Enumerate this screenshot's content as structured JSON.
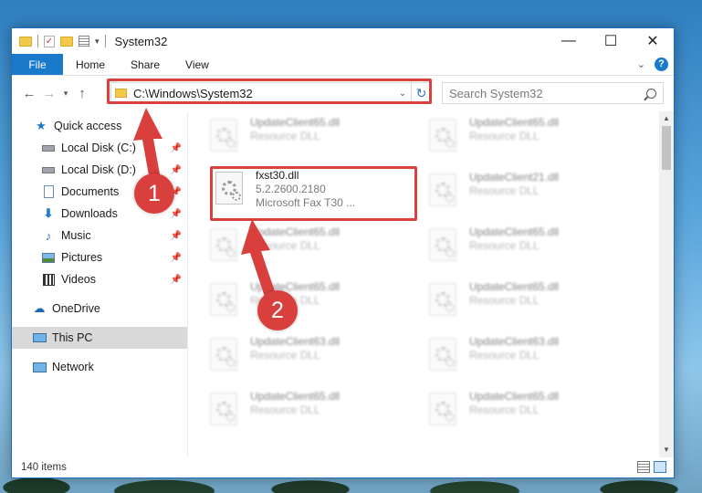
{
  "window": {
    "title": "System32",
    "controls": {
      "minimize": "—",
      "maximize": "☐",
      "close": "✕"
    }
  },
  "ribbon": {
    "tabs": [
      "File",
      "Home",
      "Share",
      "View"
    ],
    "help": "?"
  },
  "address": {
    "path": "C:\\Windows\\System32",
    "search_placeholder": "Search System32"
  },
  "nav": {
    "quick_access": "Quick access",
    "items": [
      {
        "label": "Local Disk (C:)",
        "icon": "drive-icon",
        "pinned": true
      },
      {
        "label": "Local Disk (D:)",
        "icon": "drive-icon",
        "pinned": true
      },
      {
        "label": "Documents",
        "icon": "documents-icon",
        "pinned": true
      },
      {
        "label": "Downloads",
        "icon": "downloads-icon",
        "pinned": true
      },
      {
        "label": "Music",
        "icon": "music-icon",
        "pinned": true
      },
      {
        "label": "Pictures",
        "icon": "pictures-icon",
        "pinned": true
      },
      {
        "label": "Videos",
        "icon": "videos-icon",
        "pinned": true
      }
    ],
    "onedrive": "OneDrive",
    "thispc": "This PC",
    "network": "Network"
  },
  "files": {
    "highlighted": {
      "name": "fxst30.dll",
      "version": "5.2.2600.2180",
      "description": "Microsoft  Fax T30 ..."
    },
    "blurred": [
      {
        "name": "UpdateClient65.dll",
        "type": "Resource DLL"
      },
      {
        "name": "UpdateClient65.dll",
        "type": "Resource DLL"
      },
      {
        "name": "UpdateClient21.dll",
        "type": "Resource DLL"
      },
      {
        "name": "UpdateClient65.dll",
        "type": "Resource DLL"
      },
      {
        "name": "UpdateClient65.dll",
        "type": "Resource DLL"
      },
      {
        "name": "UpdateClient65.dll",
        "type": "Resource DLL"
      },
      {
        "name": "UpdateClient65.dll",
        "type": "Resource DLL"
      },
      {
        "name": "UpdateClient63.dll",
        "type": "Resource DLL"
      },
      {
        "name": "UpdateClient63.dll",
        "type": "Resource DLL"
      },
      {
        "name": "UpdateClient65.dll",
        "type": "Resource DLL"
      },
      {
        "name": "UpdateClient65.dll",
        "type": "Resource DLL"
      }
    ]
  },
  "status": {
    "count": "140 items"
  },
  "callouts": {
    "one": "1",
    "two": "2"
  },
  "colors": {
    "accent": "#1979ca",
    "highlight": "#d9403d"
  }
}
